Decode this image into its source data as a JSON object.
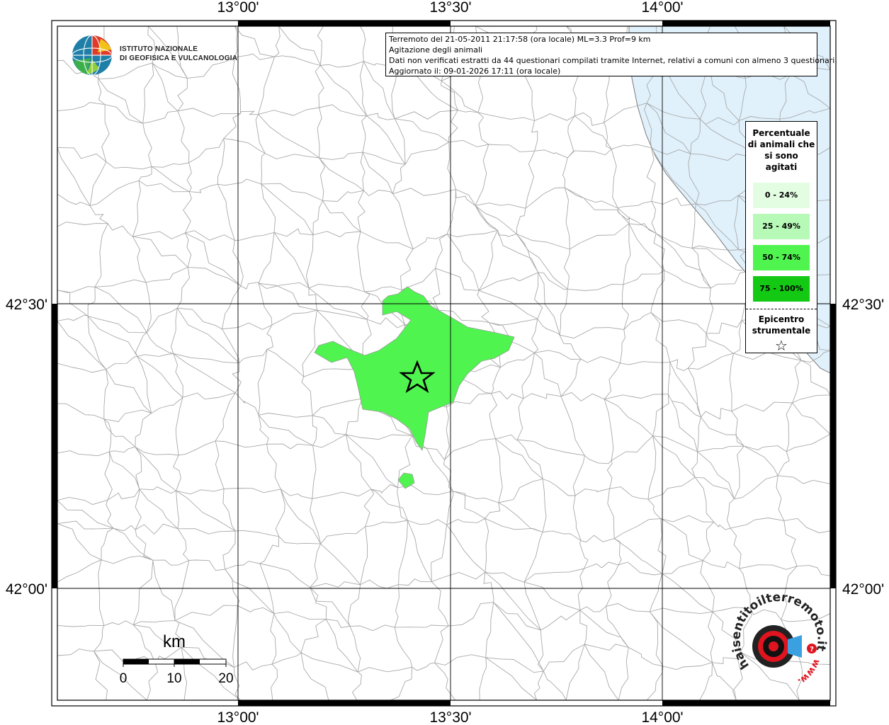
{
  "info": {
    "line1": "Terremoto del 21-05-2011 21:17:58 (ora locale) ML=3.3 Prof=9 km",
    "line2": "Agitazione degli animali",
    "line3": "Dati non verificati estratti da 44 questionari compilati tramite Internet, relativi a comuni con almeno 3 questionari.",
    "line4": "Aggiornato il: 09-01-2026 17:11 (ora locale)"
  },
  "logo": {
    "line1": "ISTITUTO NAZIONALE",
    "line2": "DI GEOFISICA E VULCANOLOGIA"
  },
  "axes": {
    "lon_top": [
      "13°00'",
      "13°30'",
      "14°00'"
    ],
    "lon_bottom": [
      "13°00'",
      "13°30'",
      "14°00'"
    ],
    "lat_left": [
      "42°30'",
      "42°00'"
    ],
    "lat_right": [
      "42°30'",
      "42°00'"
    ]
  },
  "legend": {
    "title": "Percentuale di animali che si sono agitati",
    "classes": [
      {
        "label": "0 - 24%",
        "color": "#e3fde3"
      },
      {
        "label": "25 - 49%",
        "color": "#b7f9b7"
      },
      {
        "label": "50 - 74%",
        "color": "#4ff44f"
      },
      {
        "label": "75 - 100%",
        "color": "#13c913"
      }
    ],
    "epicenter_label": "Epicentro strumentale",
    "epicenter_symbol": "☆"
  },
  "scalebar": {
    "unit": "km",
    "ticks": [
      "0",
      "10",
      "20"
    ]
  },
  "badge": {
    "text_arc": "haisentitoilterremoto.it",
    "text_arc2": "www.",
    "accent": "#e0141e"
  },
  "colors": {
    "sea": "#e0f1fc",
    "borders": "#a9a9a9",
    "affected_area": "#4ff44f"
  },
  "affected_class": "50 - 74%"
}
